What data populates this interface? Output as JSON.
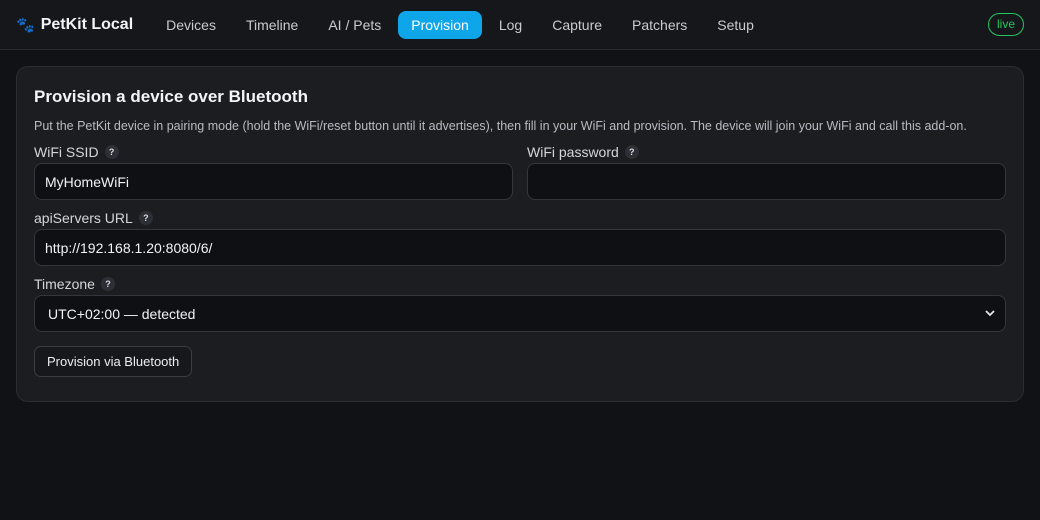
{
  "app": {
    "title": "PetKit Local",
    "logo_icon": "paw-icon"
  },
  "nav": {
    "items": [
      {
        "label": "Devices"
      },
      {
        "label": "Timeline"
      },
      {
        "label": "AI / Pets"
      },
      {
        "label": "Provision"
      },
      {
        "label": "Log"
      },
      {
        "label": "Capture"
      },
      {
        "label": "Patchers"
      },
      {
        "label": "Setup"
      }
    ],
    "active": "Provision"
  },
  "status": {
    "label": "live",
    "color": "#22c55e"
  },
  "card": {
    "title": "Provision a device over Bluetooth",
    "description": "Put the PetKit device in pairing mode (hold the WiFi/reset button until it advertises), then fill in your WiFi and provision. The device will join your WiFi and call this add-on.",
    "help_glyph": "?",
    "fields": {
      "ssid": {
        "label": "WiFi SSID",
        "value": "MyHomeWiFi"
      },
      "password": {
        "label": "WiFi password",
        "value": ""
      },
      "api": {
        "label": "apiServers URL",
        "value": "http://192.168.1.20:8080/6/"
      },
      "timezone": {
        "label": "Timezone",
        "value": "UTC+02:00 — detected"
      }
    },
    "submit_label": "Provision via Bluetooth"
  },
  "colors": {
    "accent": "#0ea5e9",
    "background": "#111215",
    "card": "#1b1d21"
  }
}
